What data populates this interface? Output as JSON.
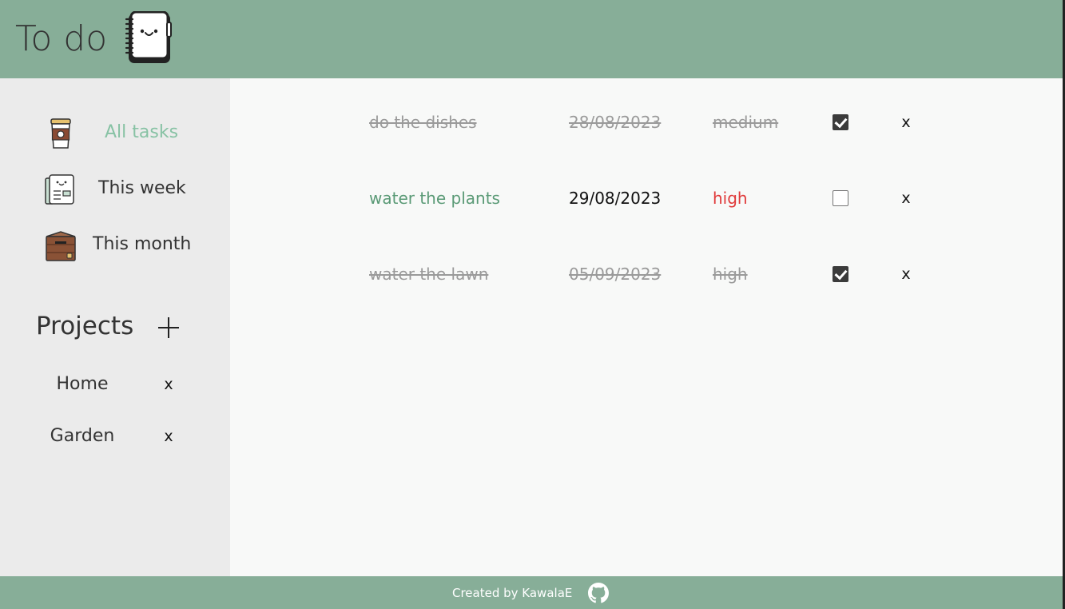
{
  "header": {
    "title": "To do",
    "logo_icon": "notebook-face-icon",
    "colors": {
      "header_bg": "#87ae98"
    }
  },
  "sidebar": {
    "nav": [
      {
        "label": "All tasks",
        "icon": "coffee-cup-icon",
        "active": true
      },
      {
        "label": "This week",
        "icon": "newspaper-face-icon",
        "active": false
      },
      {
        "label": "This month",
        "icon": "wooden-crate-icon",
        "active": false
      }
    ],
    "projects_title": "Projects",
    "add_icon": "plus-icon",
    "projects": [
      {
        "name": "Home",
        "delete_label": "x"
      },
      {
        "name": "Garden",
        "delete_label": "x"
      }
    ]
  },
  "tasks": [
    {
      "name": "do the dishes",
      "date": "28/08/2023",
      "priority": "medium",
      "done": true,
      "delete_label": "x"
    },
    {
      "name": "water the plants",
      "date": "29/08/2023",
      "priority": "high",
      "done": false,
      "delete_label": "x"
    },
    {
      "name": "water the lawn",
      "date": "05/09/2023",
      "priority": "high",
      "done": true,
      "delete_label": "x"
    }
  ],
  "footer": {
    "text": "Created by KawalaE",
    "icon": "github-icon"
  }
}
